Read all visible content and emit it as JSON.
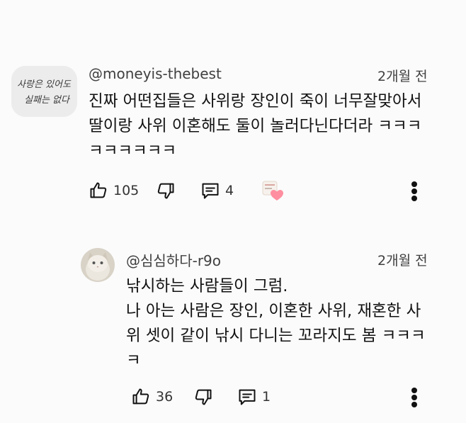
{
  "comments": [
    {
      "author": "@moneyis-thebest",
      "time": "2개월 전",
      "text": "진짜 어떤집들은 사위랑 장인이 죽이 너무잘맞아서\n딸이랑 사위 이혼해도 둘이 놀러다닌다더라 ㅋㅋㅋ\nㅋㅋㅋㅋㅋㅋ",
      "avatar_text": [
        "사랑은 있어도",
        "실패는 없다"
      ],
      "likes": "105",
      "replies": "4",
      "creator_heart": true
    },
    {
      "author": "@심심하다-r9o",
      "time": "2개월 전",
      "text": "낚시하는 사람들이 그럼.\n나 아는 사람은 장인, 이혼한 사위, 재혼한 사\n위 셋이 같이 낚시 다니는 꼬라지도 봄 ㅋㅋㅋ\nㅋ",
      "likes": "36",
      "replies": "1"
    }
  ],
  "icons": [
    "thumb-up-icon",
    "thumb-down-icon",
    "reply-icon",
    "more-vertical-icon",
    "creator-heart-icon"
  ]
}
